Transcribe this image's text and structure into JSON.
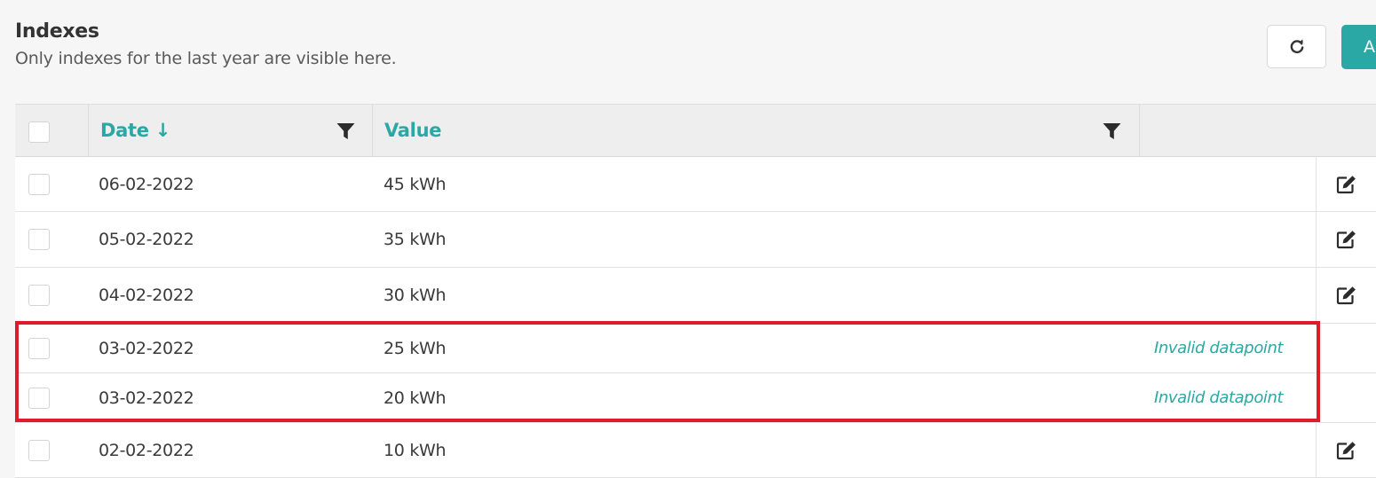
{
  "header": {
    "title": "Indexes",
    "subtitle": "Only indexes for the last year are visible here."
  },
  "toolbar": {
    "refresh_icon": "refresh-icon",
    "add_label": "A",
    "accent_color": "#2aa8a5"
  },
  "table": {
    "columns": {
      "date": "Date ↓",
      "value": "Value"
    },
    "rows": [
      {
        "date": "06-02-2022",
        "value": "45 kWh",
        "status": "",
        "editable": true
      },
      {
        "date": "05-02-2022",
        "value": "35 kWh",
        "status": "",
        "editable": true
      },
      {
        "date": "04-02-2022",
        "value": "30 kWh",
        "status": "",
        "editable": true
      },
      {
        "date": "03-02-2022",
        "value": "25 kWh",
        "status": "Invalid datapoint",
        "editable": false
      },
      {
        "date": "03-02-2022",
        "value": "20 kWh",
        "status": "Invalid datapoint",
        "editable": false
      },
      {
        "date": "02-02-2022",
        "value": "10 kWh",
        "status": "",
        "editable": true
      }
    ]
  },
  "highlight_color": "#de1b29"
}
